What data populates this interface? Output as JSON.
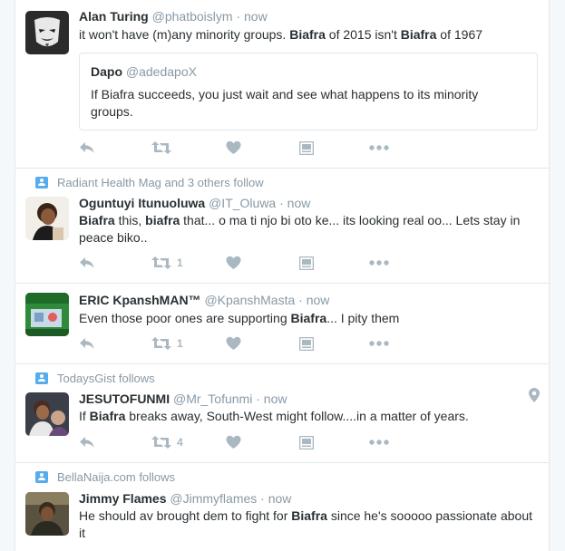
{
  "tweets": [
    {
      "name": "Alan Turing",
      "username": "@phatboislym",
      "sep": "·",
      "time": "now",
      "text": [
        {
          "t": "it won't have (m)any minority groups. "
        },
        {
          "t": "Biafra",
          "b": true
        },
        {
          "t": " of 2015 isn't "
        },
        {
          "t": "Biafra",
          "b": true
        },
        {
          "t": " of 1967"
        }
      ],
      "quote": {
        "name": "Dapo",
        "username": "@adedapoX",
        "text": "If Biafra succeeds, you just wait and see what happens to its minority groups."
      }
    },
    {
      "context": "Radiant Health Mag and 3 others follow",
      "name": "Oguntuyi Itunuoluwa",
      "username": "@IT_Oluwa",
      "sep": "·",
      "time": "now",
      "text": [
        {
          "t": "Biafra",
          "b": true
        },
        {
          "t": " this, "
        },
        {
          "t": "biafra",
          "b": true
        },
        {
          "t": " that... o ma ti njo bi oto ke... its looking real oo... Lets stay in peace biko.."
        }
      ],
      "retweets": "1"
    },
    {
      "name": "ERIC KpanshMAN™",
      "username": "@KpanshMasta",
      "sep": "·",
      "time": "now",
      "text": [
        {
          "t": "Even those poor ones are supporting "
        },
        {
          "t": "Biafra",
          "b": true
        },
        {
          "t": "... I pity them"
        }
      ],
      "retweets": "1"
    },
    {
      "context": "TodaysGist follows",
      "name": "JESUTOFUNMI",
      "username": "@Mr_Tofunmi",
      "sep": "·",
      "time": "now",
      "text": [
        {
          "t": "If "
        },
        {
          "t": "Biafra",
          "b": true
        },
        {
          "t": " breaks away, South-West might follow....in a matter of years."
        }
      ],
      "retweets": "4"
    },
    {
      "context": "BellaNaija.com follows",
      "name": "Jimmy Flames",
      "username": "@Jimmyflames",
      "sep": "·",
      "time": "now",
      "text": [
        {
          "t": "He should av brought dem to fight for "
        },
        {
          "t": "Biafra",
          "b": true
        },
        {
          "t": " since he's sooooo passionate about it"
        }
      ]
    }
  ],
  "icons": {
    "reply": "reply-icon",
    "retweet": "retweet-icon",
    "like": "heart-icon",
    "media": "media-icon",
    "more": "more-icon",
    "location": "location-pin-icon"
  },
  "colors": {
    "muted": "#8899a6",
    "action": "#aab8c2",
    "follow_icon": "#55acee"
  }
}
